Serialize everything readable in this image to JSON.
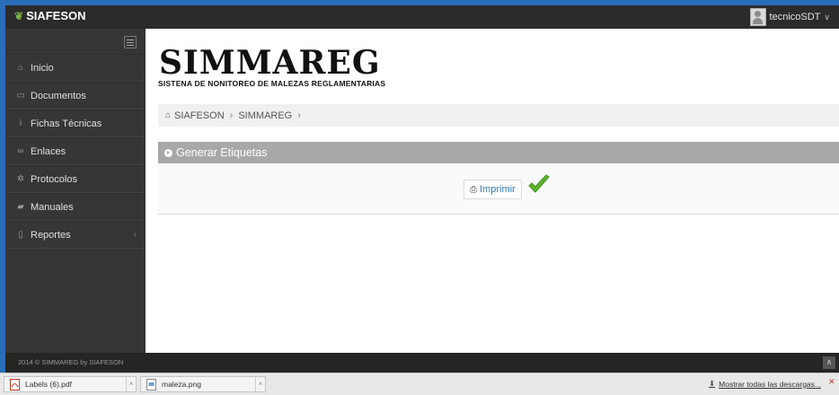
{
  "topbar": {
    "brand": "SIAFESON",
    "user": "tecnicoSDT"
  },
  "sidebar": {
    "items": [
      {
        "label": "Inicio",
        "icon": "home-icon"
      },
      {
        "label": "Documentos",
        "icon": "folder-icon"
      },
      {
        "label": "Fichas Técnicas",
        "icon": "info-icon"
      },
      {
        "label": "Enlaces",
        "icon": "link-icon"
      },
      {
        "label": "Protocolos",
        "icon": "gear-icon"
      },
      {
        "label": "Manuales",
        "icon": "book-icon"
      },
      {
        "label": "Reportes",
        "icon": "file-icon",
        "has_submenu": true
      }
    ]
  },
  "header": {
    "title": "SIMMAREG",
    "subtitle": "SISTENA DE NONITOREO DE MALEZAS REGLAMENTARIAS"
  },
  "breadcrumb": {
    "items": [
      "SIAFESON",
      "SIMMAREG"
    ]
  },
  "panel": {
    "title": "Generar Etiquetas",
    "print_label": "Imprimir"
  },
  "footer": {
    "text": "2014 © SIMMAREG by SIAFESON"
  },
  "downloads": {
    "items": [
      "Labels (6).pdf",
      "maleza.png"
    ],
    "show_all": "Mostrar todas las descargas..."
  },
  "colors": {
    "accent_link": "#337ab7",
    "check_green": "#5cb82a",
    "panel_header": "#a8a8a8",
    "sidebar_bg": "#363636"
  }
}
